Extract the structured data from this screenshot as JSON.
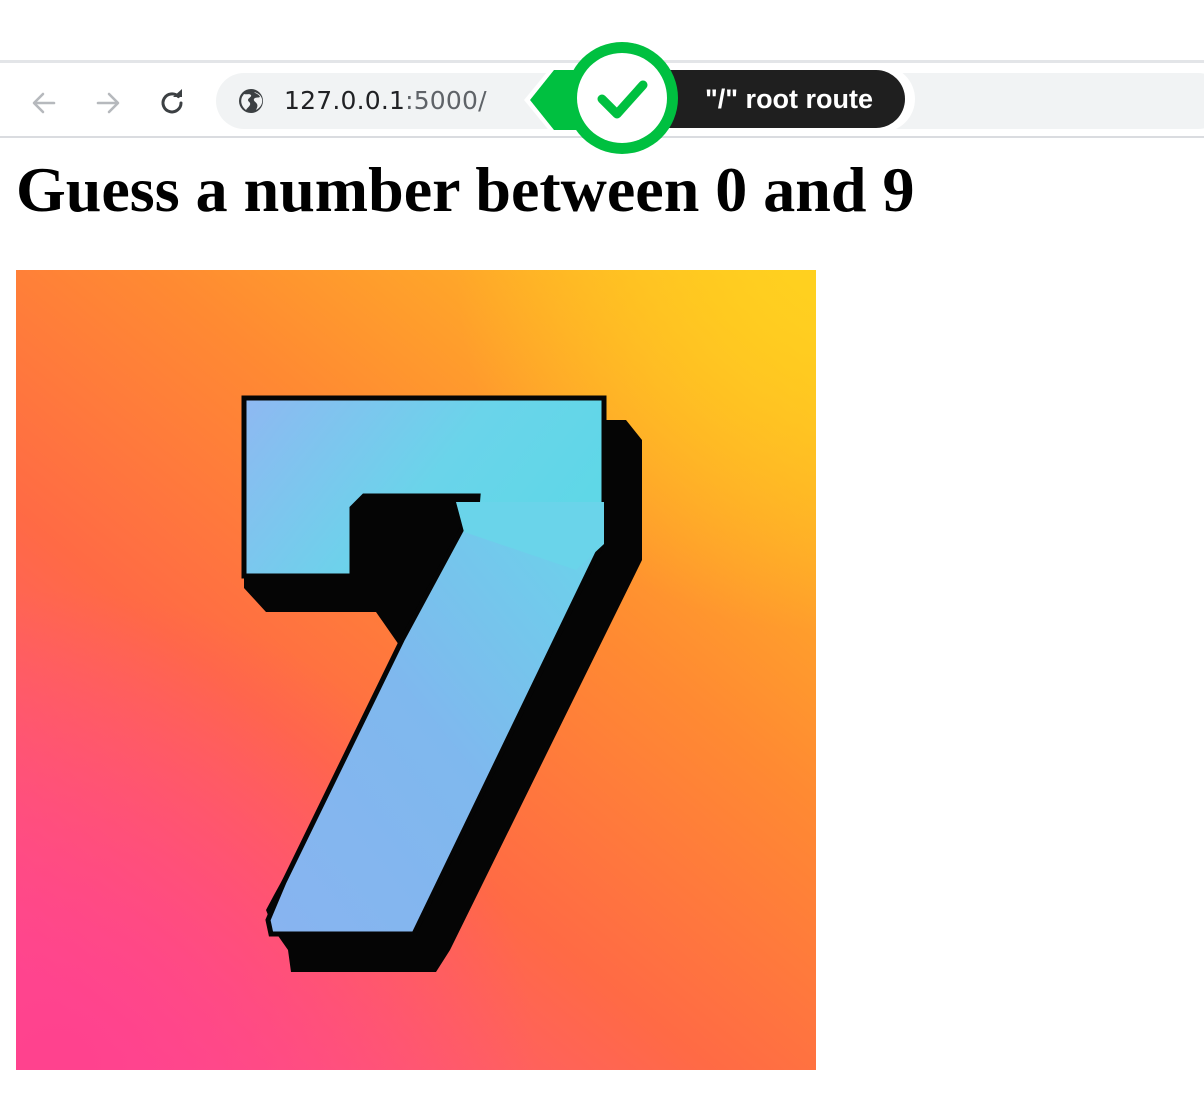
{
  "browser": {
    "url_host": "127.0.0.1",
    "url_rest": ":5000/",
    "icons": {
      "back": "arrow-left-icon",
      "forward": "arrow-right-icon",
      "reload": "reload-icon",
      "site_info": "globe-icon"
    }
  },
  "annotation": {
    "label": "\"/\" root route",
    "icon": "checkmark-icon",
    "colors": {
      "accent": "#00c040",
      "badge": "#1f1f1f"
    }
  },
  "page": {
    "title": "Guess a number between 0 and 9",
    "image": {
      "digit": "7",
      "colors": {
        "digit_fill": "#7fb8ee",
        "digit_highlight": "#6ad4ea",
        "shadow": "#050505"
      }
    }
  }
}
